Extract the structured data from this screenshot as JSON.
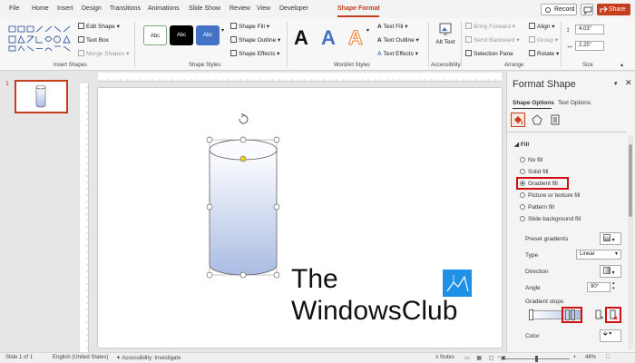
{
  "menu": {
    "tabs": [
      "File",
      "Home",
      "Insert",
      "Design",
      "Transitions",
      "Animations",
      "Slide Show",
      "Review",
      "View",
      "Developer",
      "Shape Format"
    ],
    "record_label": "Record",
    "share_label": "Share"
  },
  "ribbon": {
    "insert_shapes": {
      "label": "Insert Shapes",
      "edit_shape": "Edit Shape",
      "text_box": "Text Box",
      "merge_shapes": "Merge Shapes"
    },
    "shape_styles": {
      "label": "Shape Styles",
      "preset_text": "Abc",
      "shape_fill": "Shape Fill",
      "shape_outline": "Shape Outline",
      "shape_effects": "Shape Effects"
    },
    "wordart": {
      "label": "WordArt Styles",
      "letter": "A",
      "text_fill": "Text Fill",
      "text_outline": "Text Outline",
      "text_effects": "Text Effects"
    },
    "accessibility": {
      "label": "Accessibility",
      "alt_text": "Alt Text"
    },
    "arrange": {
      "label": "Arrange",
      "bring_forward": "Bring Forward",
      "send_backward": "Send Backward",
      "selection_pane": "Selection Pane",
      "align": "Align",
      "group": "Group",
      "rotate": "Rotate"
    },
    "size": {
      "label": "Size",
      "height": "4.03\"",
      "width": "2.25\""
    }
  },
  "thumbnail": {
    "number": "1"
  },
  "watermark": {
    "line1": "The",
    "line2": "WindowsClub"
  },
  "panel": {
    "title": "Format Shape",
    "tab_options": "Shape Options",
    "tab_text": "Text Options",
    "fill_header": "Fill",
    "fill_options": [
      "No fill",
      "Solid fill",
      "Gradient fill",
      "Picture or texture fill",
      "Pattern fill",
      "Slide background fill"
    ],
    "selected_fill": "Gradient fill",
    "preset_gradients": "Preset gradients",
    "type_label": "Type",
    "type_value": "Linear",
    "direction_label": "Direction",
    "angle_label": "Angle",
    "angle_value": "90°",
    "gradient_stops": "Gradient stops",
    "color_label": "Color"
  },
  "status": {
    "slide": "Slide 1 of 1",
    "language": "English (United States)",
    "accessibility": "Accessibility: Investigate",
    "notes": "Notes",
    "zoom": "46%"
  },
  "colors": {
    "accent": "#c43e1c",
    "highlight": "#d01010",
    "gradient_top": "#ffffff",
    "gradient_bottom": "#aabce3"
  }
}
